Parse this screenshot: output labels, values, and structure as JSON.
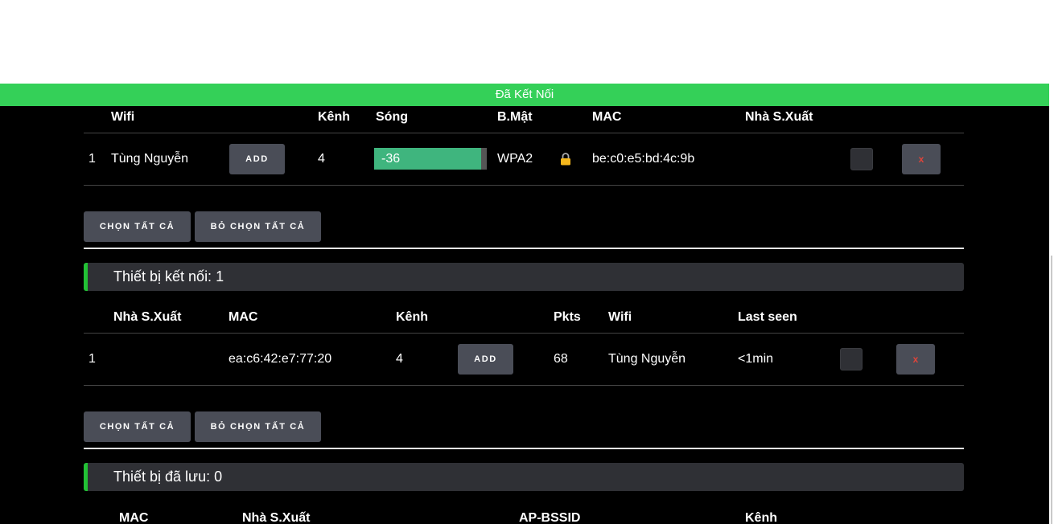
{
  "status_bar": {
    "text": "Đã Kết Nối",
    "color": "#34d058"
  },
  "ap_table": {
    "headers": {
      "wifi": "Wifi",
      "channel": "Kênh",
      "signal": "Sóng",
      "security": "B.Mật",
      "mac": "MAC",
      "vendor": "Nhà S.Xuất"
    },
    "rows": [
      {
        "index": "1",
        "wifi": "Tùng Nguyễn",
        "add_label": "ADD",
        "channel": "4",
        "signal": "-36",
        "signal_level": 0.95,
        "security": "WPA2",
        "lock_icon": "lock-icon",
        "mac": "be:c0:e5:bd:4c:9b",
        "vendor": "",
        "remove_label": "x"
      }
    ]
  },
  "ap_actions": {
    "select_all": "CHỌN TẤT CẢ",
    "deselect_all": "BỎ CHỌN TẤT CẢ"
  },
  "stations_section": {
    "title": "Thiết bị kết nối: 1"
  },
  "station_table": {
    "headers": {
      "vendor": "Nhà S.Xuất",
      "mac": "MAC",
      "channel": "Kênh",
      "pkts": "Pkts",
      "wifi": "Wifi",
      "last_seen": "Last seen"
    },
    "rows": [
      {
        "index": "1",
        "vendor": "",
        "mac": "ea:c6:42:e7:77:20",
        "channel": "4",
        "add_label": "ADD",
        "pkts": "68",
        "wifi": "Tùng Nguyễn",
        "last_seen": "<1min",
        "remove_label": "x"
      }
    ]
  },
  "station_actions": {
    "select_all": "CHỌN TẤT CẢ",
    "deselect_all": "BỎ CHỌN TẤT CẢ"
  },
  "saved_section": {
    "title": "Thiết bị đã lưu: 0"
  },
  "saved_table": {
    "headers": {
      "mac": "MAC",
      "vendor": "Nhà S.Xuất",
      "ap_bssid": "AP-BSSID",
      "channel": "Kênh"
    }
  },
  "colors": {
    "accent_green": "#22c135",
    "signal_green": "#3fb57e",
    "remove_red": "#e0443a",
    "button_gray": "#4a4d57"
  }
}
